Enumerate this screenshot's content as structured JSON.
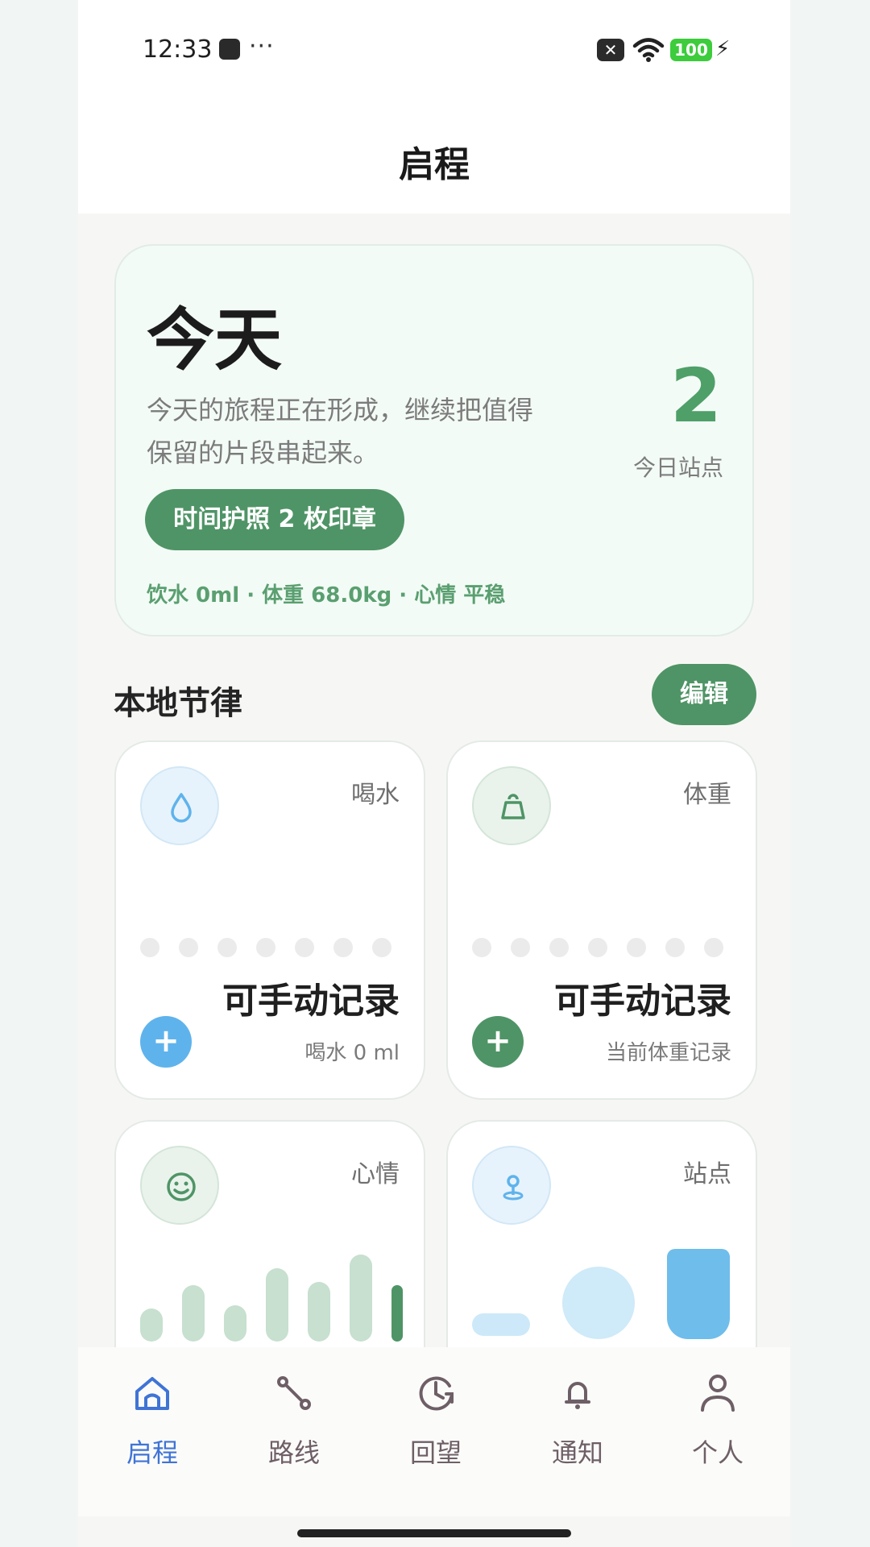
{
  "status_bar": {
    "time": "12:33",
    "overflow": "···",
    "x_icon": "✕",
    "battery": "100",
    "charging": "⚡"
  },
  "app": {
    "title": "启程"
  },
  "hero": {
    "title": "今天",
    "description": "今天的旅程正在形成，继续把值得保留的片段串起来。",
    "count": "2",
    "count_label": "今日站点",
    "badge": "时间护照 2 枚印章",
    "summary": "饮水 0ml · 体重 68.0kg · 心情 平稳"
  },
  "section": {
    "title": "本地节律",
    "edit_label": "编辑"
  },
  "tiles": [
    {
      "label": "喝水",
      "value": "可手动记录",
      "caption": "喝水 0 ml",
      "icon": "water-drop-icon",
      "add": "+"
    },
    {
      "label": "体重",
      "value": "可手动记录",
      "caption": "当前体重记录",
      "icon": "weight-icon",
      "add": "+"
    },
    {
      "label": "心情",
      "icon": "smile-icon",
      "mood_levels": [
        0.2,
        0.55,
        0.25,
        0.8,
        0.6,
        1.0,
        0.55
      ]
    },
    {
      "label": "站点",
      "icon": "location-pin-icon"
    }
  ],
  "nav": [
    {
      "label": "启程",
      "icon": "home-icon",
      "active": true
    },
    {
      "label": "路线",
      "icon": "route-icon"
    },
    {
      "label": "回望",
      "icon": "history-icon"
    },
    {
      "label": "通知",
      "icon": "bell-icon"
    },
    {
      "label": "个人",
      "icon": "person-icon"
    }
  ],
  "colors": {
    "accent": "#4f9466",
    "water": "#5fb3ec",
    "nav_active": "#3f74d6"
  }
}
